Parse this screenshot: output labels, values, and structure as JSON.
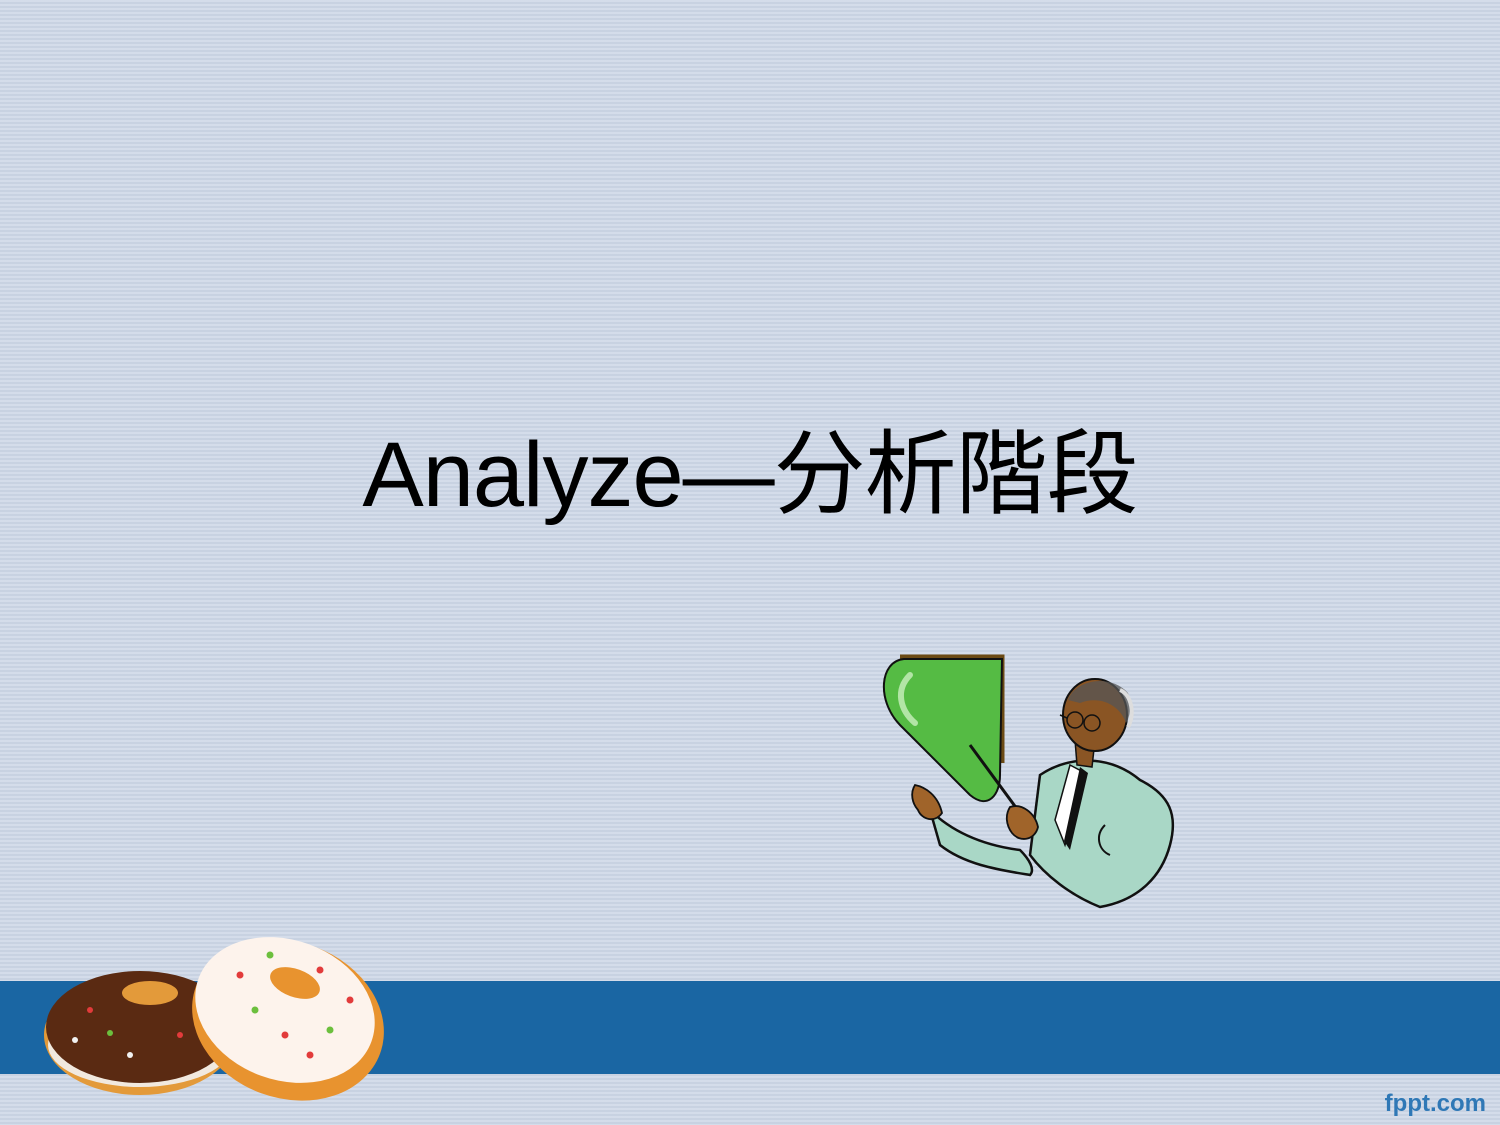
{
  "slide": {
    "title": "Analyze—分析階段",
    "brand": "fppt.com"
  },
  "colors": {
    "background": "#cbd5e5",
    "band": "#1a66a3",
    "brand_text": "#2f78b6",
    "board_green": "#55bb44"
  },
  "illustrations": {
    "presenter": "teacher-with-pointer-clipart",
    "decoration": "donuts-clipart"
  }
}
